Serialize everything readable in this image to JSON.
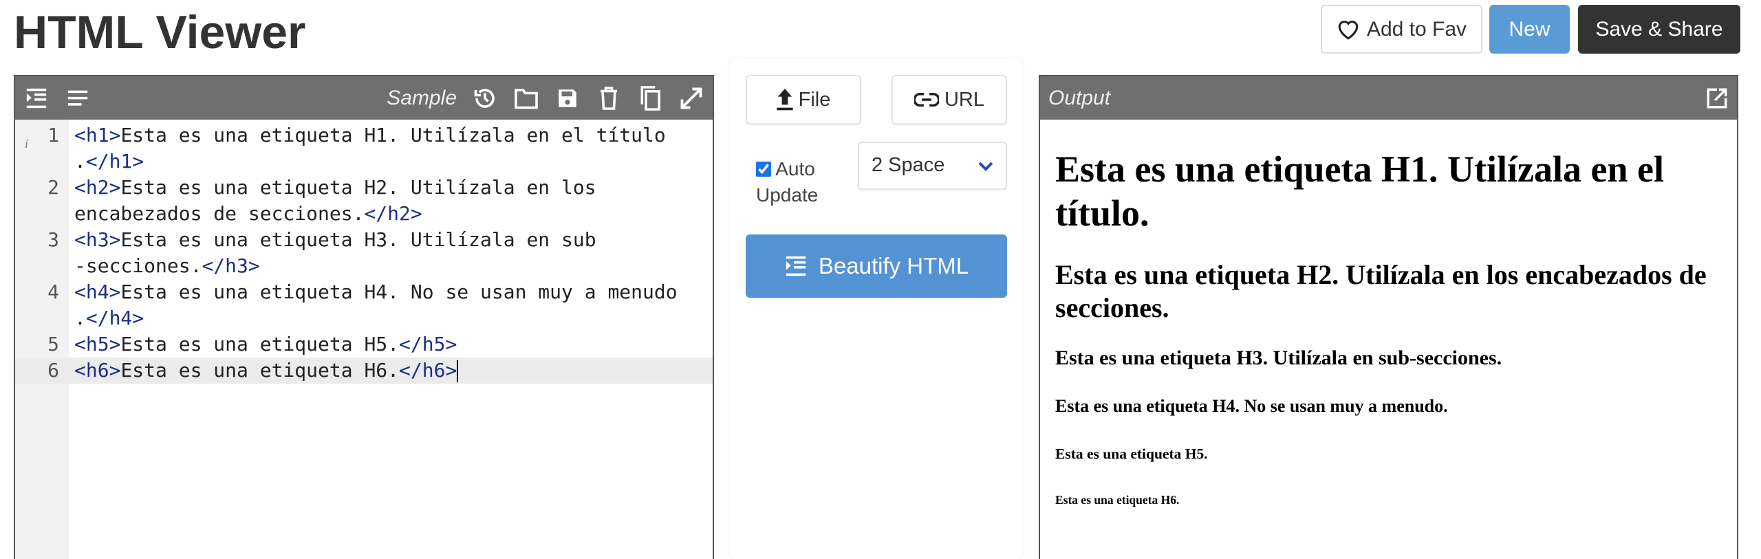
{
  "app": {
    "title": "HTML Viewer"
  },
  "top_buttons": {
    "fav": "Add to Fav",
    "new": "New",
    "save": "Save & Share"
  },
  "colors": {
    "header": "#6f6f6f",
    "accent": "#5392d3",
    "new": "#5b9bd5",
    "dark": "#333333",
    "tag": "#1c2e8a"
  },
  "editor": {
    "sample_label": "Sample",
    "icons": [
      "indent-icon",
      "align-justify-icon",
      "history-icon",
      "folder-icon",
      "save-icon",
      "trash-icon",
      "copy-icon",
      "expand-icon"
    ],
    "lines": [
      {
        "num": "1",
        "rows": [
          [
            [
              "tag",
              "<h1>"
            ],
            [
              "text",
              "Esta es una etiqueta H1. Utilízala en el título"
            ]
          ],
          [
            [
              "text",
              "."
            ],
            [
              "tag",
              "</h1>"
            ]
          ]
        ]
      },
      {
        "num": "2",
        "rows": [
          [
            [
              "tag",
              "<h2>"
            ],
            [
              "text",
              "Esta es una etiqueta H2. Utilízala en los"
            ]
          ],
          [
            [
              "text",
              "encabezados de secciones."
            ],
            [
              "tag",
              "</h2>"
            ]
          ]
        ]
      },
      {
        "num": "3",
        "rows": [
          [
            [
              "tag",
              "<h3>"
            ],
            [
              "text",
              "Esta es una etiqueta H3. Utilízala en sub"
            ]
          ],
          [
            [
              "text",
              "-secciones."
            ],
            [
              "tag",
              "</h3>"
            ]
          ]
        ]
      },
      {
        "num": "4",
        "rows": [
          [
            [
              "tag",
              "<h4>"
            ],
            [
              "text",
              "Esta es una etiqueta H4. No se usan muy a menudo"
            ]
          ],
          [
            [
              "text",
              "."
            ],
            [
              "tag",
              "</h4>"
            ]
          ]
        ]
      },
      {
        "num": "5",
        "rows": [
          [
            [
              "tag",
              "<h5>"
            ],
            [
              "text",
              "Esta es una etiqueta H5."
            ],
            [
              "tag",
              "</h5>"
            ]
          ]
        ]
      },
      {
        "num": "6",
        "active": true,
        "rows": [
          [
            [
              "tag",
              "<h6>"
            ],
            [
              "text",
              "Esta es una etiqueta H6."
            ],
            [
              "tag",
              "</h6>"
            ]
          ]
        ]
      }
    ]
  },
  "controls": {
    "file": "File",
    "url": "URL",
    "auto_update": "Auto Update",
    "auto_update_checked": true,
    "indent_value": "2 Space",
    "beautify": "Beautify HTML"
  },
  "output": {
    "title": "Output",
    "h1": "Esta es una etiqueta H1. Utilízala en el título.",
    "h2": "Esta es una etiqueta H2. Utilízala en los encabezados de secciones.",
    "h3": "Esta es una etiqueta H3. Utilízala en sub-secciones.",
    "h4": "Esta es una etiqueta H4. No se usan muy a menudo.",
    "h5": "Esta es una etiqueta H5.",
    "h6": "Esta es una etiqueta H6."
  }
}
